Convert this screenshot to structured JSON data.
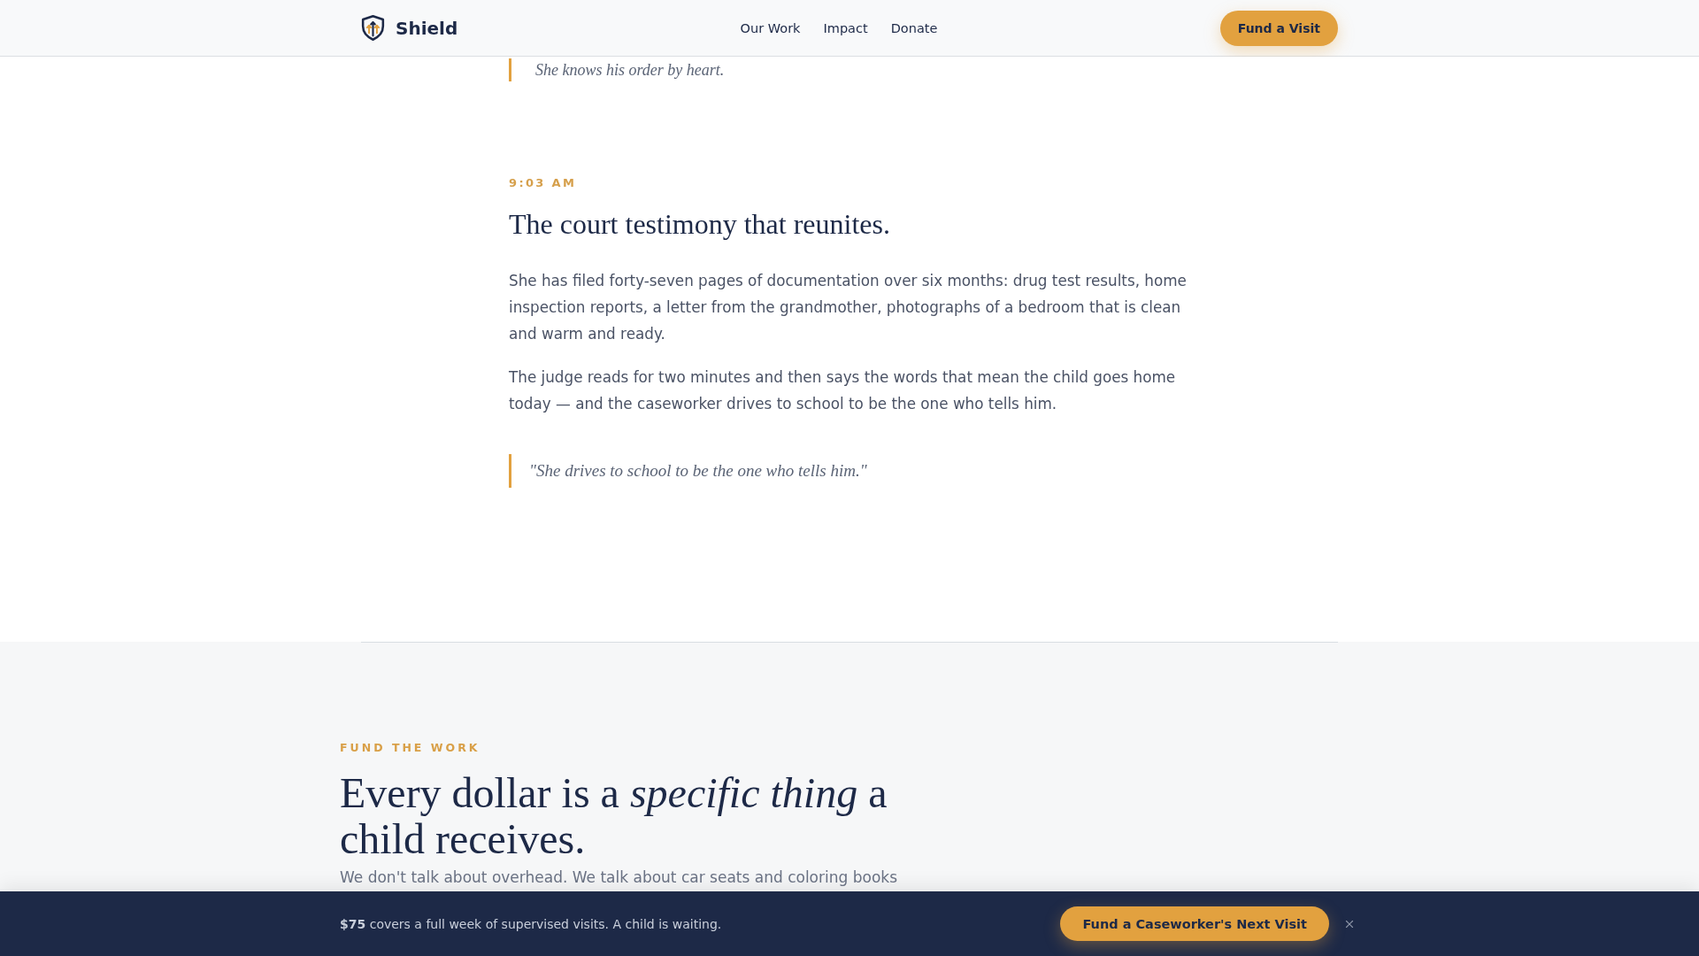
{
  "header": {
    "brand": "Shield",
    "nav": [
      "Our Work",
      "Impact",
      "Donate"
    ],
    "cta": "Fund a Visit"
  },
  "previous_quote": "She knows his order by heart.",
  "story": {
    "time": "9:03 AM",
    "title": "The court testimony that reunites.",
    "paragraphs": [
      "She has filed forty-seven pages of documentation over six months: drug test results, home inspection reports, a letter from the grandmother, photographs of a bedroom that is clean and warm and ready.",
      "The judge reads for two minutes and then says the words that mean the child goes home today — and the caseworker drives to school to be the one who tells him."
    ],
    "quote": "\"She drives to school to be the one who tells him.\""
  },
  "fund": {
    "eyebrow": "FUND THE WORK",
    "title": "Every dollar is a *specific thing* a child receives.",
    "intro": "We don't talk about overhead. We talk about car seats and coloring books"
  },
  "banner": {
    "message": "**$75** covers a full week of supervised visits. A child is waiting.",
    "button": "Fund a Caseworker's Next Visit"
  }
}
